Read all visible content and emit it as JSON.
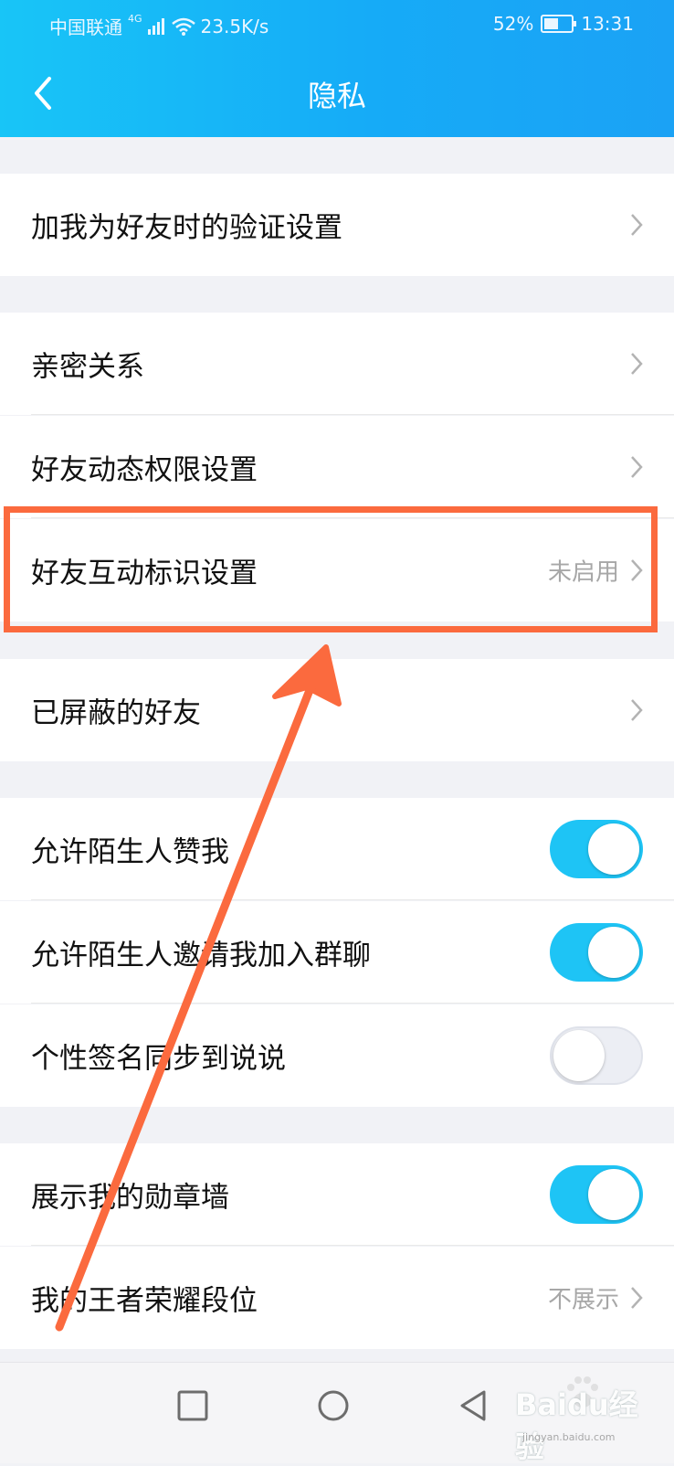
{
  "status_bar": {
    "carrier": "中国联通",
    "network": "4G",
    "speed": "23.5K/s",
    "battery": "52%",
    "battery_level": 0.52,
    "time": "13:31"
  },
  "header": {
    "title": "隐私"
  },
  "rows": {
    "verification": {
      "label": "加我为好友时的验证设置"
    },
    "intimacy": {
      "label": "亲密关系"
    },
    "moments_perm": {
      "label": "好友动态权限设置"
    },
    "interaction_mark": {
      "label": "好友互动标识设置",
      "value": "未启用"
    },
    "blocked": {
      "label": "已屏蔽的好友"
    },
    "like_me": {
      "label": "允许陌生人赞我",
      "enabled": true
    },
    "invite_group": {
      "label": "允许陌生人邀请我加入群聊",
      "enabled": true
    },
    "signature_sync": {
      "label": "个性签名同步到说说",
      "enabled": false
    },
    "medal_wall": {
      "label": "展示我的勋章墙",
      "enabled": true
    },
    "honor_rank": {
      "label": "我的王者荣耀段位",
      "value": "不展示"
    }
  },
  "watermark": {
    "brand": "Baidu经验",
    "url": "jingyan.baidu.com"
  },
  "colors": {
    "header": "#16abf7",
    "toggle_on": "#1ec4f5",
    "annotation": "#fb6a3e"
  }
}
